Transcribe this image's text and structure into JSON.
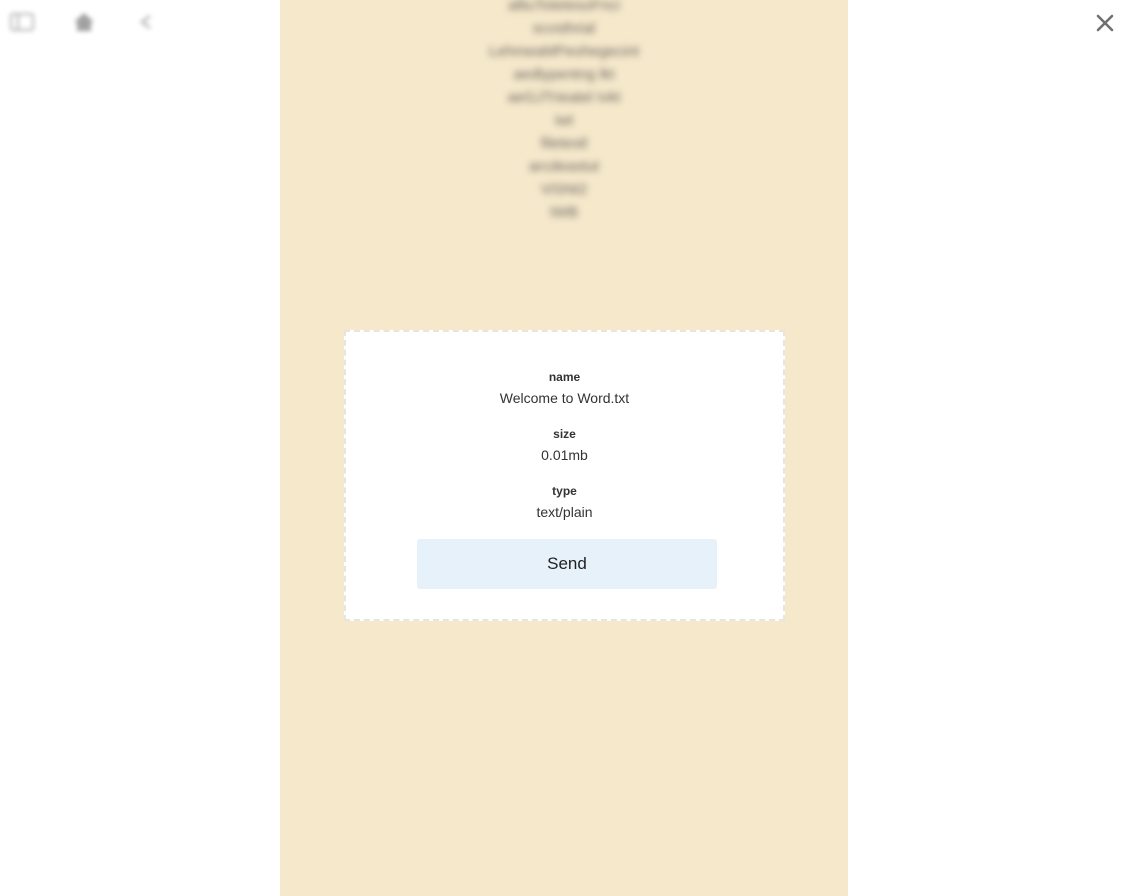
{
  "toolbar": {
    "icons": [
      "menu-icon",
      "home-icon",
      "back-icon"
    ]
  },
  "background_list": {
    "items": [
      "alliuTotetesoFnci",
      "scvsthrial",
      "LehmeaMPeohegecint",
      "aedlypentng lkt",
      "aeGJTrieatel Ivkt",
      "iwt",
      "filetestl",
      "arcdeastut",
      "ViSNt2",
      "IWB"
    ]
  },
  "file_card": {
    "name_label": "name",
    "name_value": "Welcome to Word.txt",
    "size_label": "size",
    "size_value": "0.01mb",
    "type_label": "type",
    "type_value": "text/plain",
    "send_label": "Send"
  },
  "colors": {
    "column_bg": "#f5e8cb",
    "send_bg": "#e6f1fa",
    "close": "#707070"
  }
}
